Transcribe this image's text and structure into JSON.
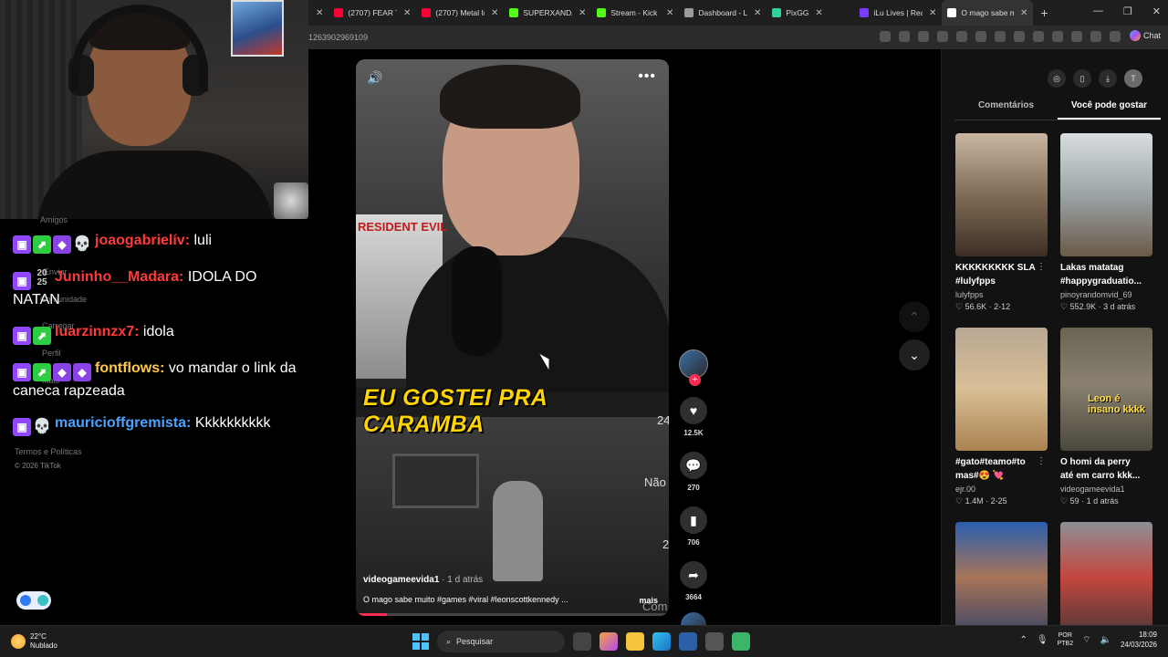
{
  "browser": {
    "tabs": [
      {
        "label": "(2707) FEAR THE",
        "color": "#ff0033"
      },
      {
        "label": "(2707) Metal Ins",
        "color": "#ff0033"
      },
      {
        "label": "SUPERXANDAO",
        "color": "#53fc18"
      },
      {
        "label": "Stream - Kick Da",
        "color": "#53fc18"
      },
      {
        "label": "Dashboard - Liv",
        "color": "#9b9b9b"
      },
      {
        "label": "PixGG",
        "color": "#31d09e"
      },
      {
        "label": "iLu Lives | React",
        "color": "#7d3cff"
      },
      {
        "label": "O mago sabe m",
        "color": "#ffffff",
        "active": true
      }
    ],
    "new_tab_icon": "plus-icon",
    "url": "1263902969109",
    "chat_label": "Chat"
  },
  "stream_chat": {
    "ghost_texts": [
      "Amigos",
      "Enviar",
      "Comunidade",
      "Carregar",
      "Perfil",
      "Mais",
      "Termos e Políticas"
    ],
    "messages": [
      {
        "badges": [
          "twitch",
          "green",
          "purple",
          "skull"
        ],
        "user": "joaogabrielív:",
        "user_color": "#ff3a3a",
        "text": "luli"
      },
      {
        "badges": [
          "twitch",
          "year"
        ],
        "year": "20\n25",
        "user": "Juninho__Madara:",
        "user_color": "#ff3a3a",
        "text": "IDOLA DO NATAN"
      },
      {
        "badges": [
          "twitch",
          "green"
        ],
        "user": "luarzinnzx7:",
        "user_color": "#ff3a3a",
        "text": "idola"
      },
      {
        "badges": [
          "twitch",
          "green",
          "purple",
          "purple"
        ],
        "user": "fontflows:",
        "user_color": "#ffc94a",
        "text": "vo mandar o link da caneca rapzeada"
      },
      {
        "badges": [
          "twitch",
          "skull"
        ],
        "user": "mauricioffgremista:",
        "user_color": "#4aa3ff",
        "text": "Kkkkkkkkkk"
      }
    ],
    "copyright": "© 2026 TikTok"
  },
  "video": {
    "box_title": "RESIDENT EVIL",
    "caption": "EU GOSTEI PRA CARAMBA",
    "side_texts": [
      "24",
      "Não",
      "2",
      "Com"
    ],
    "author": "videogameevida1",
    "ago": "· 1 d atrás",
    "description": "O mago sabe muito #games #viral #leonscottkennedy ...",
    "more": "mais",
    "progress": 0.1
  },
  "actions": {
    "likes": "12.5K",
    "comments": "270",
    "saves": "706",
    "shares": "3664"
  },
  "panel": {
    "tabs": [
      "Comentários",
      "Você pode gostar"
    ],
    "user_initial": "T",
    "cards": [
      {
        "title": "KKKKKKKKK SLA #lulyfpps",
        "author": "lulyfpps",
        "likes": "56.6K",
        "date": "2-12",
        "thumb_text": ""
      },
      {
        "title": "Lakas matatag #happygraduatio...",
        "author": "pinoyrandomvid_69",
        "likes": "552.9K",
        "date": "3 d atrás",
        "thumb_text": ""
      },
      {
        "title": "#gato#teamo#to mas#😍 💘",
        "author": "ejr.00",
        "likes": "1.4M",
        "date": "2-25",
        "thumb_text": ""
      },
      {
        "title": "O homi da perry até em carro kkk...",
        "author": "videogameevida1",
        "likes": "59",
        "date": "1 d atrás",
        "thumb_text": "Leon é insano kkkk"
      },
      {
        "title": "",
        "author": "",
        "likes": "",
        "date": "",
        "thumb_text": ""
      },
      {
        "title": "",
        "author": "",
        "likes": "",
        "date": "",
        "thumb_text": ""
      }
    ]
  },
  "taskbar": {
    "temp": "22°C",
    "weather": "Nublado",
    "search_placeholder": "Pesquisar",
    "lang": "POR",
    "layout": "PTB2",
    "time": "18:09",
    "date": "24/03/2026"
  }
}
